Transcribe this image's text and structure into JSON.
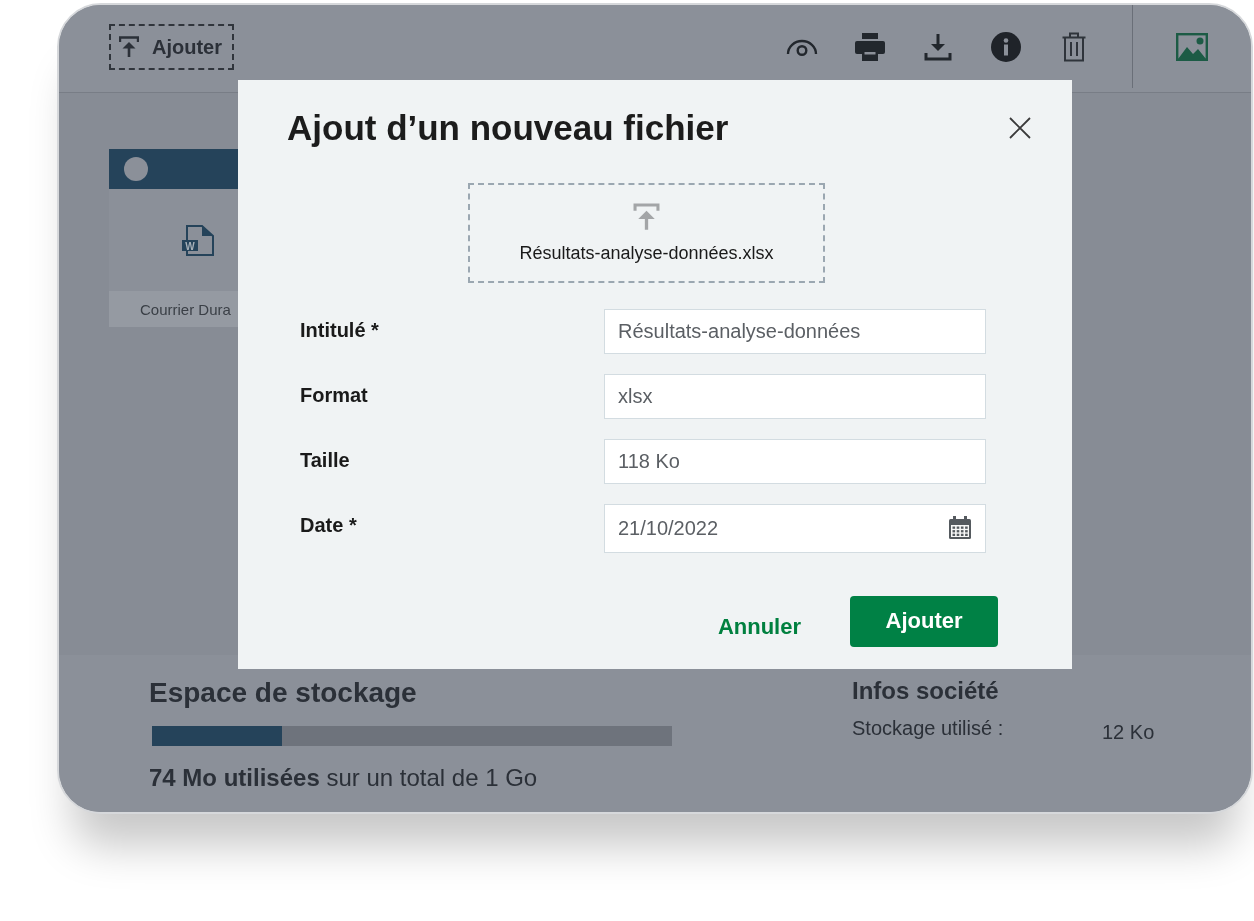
{
  "toolbar": {
    "add_button": "Ajouter"
  },
  "files": [
    {
      "name": "Courrier Dura",
      "type_badge": "W"
    }
  ],
  "dialog": {
    "title": "Ajout d’un nouveau fichier",
    "dropzone": {
      "filename": "Résultats-analyse-données.xlsx"
    },
    "fields": [
      {
        "label": "Intitulé *",
        "value": "Résultats-analyse-données",
        "kind": "text"
      },
      {
        "label": "Format",
        "value": "xlsx",
        "kind": "text"
      },
      {
        "label": "Taille",
        "value": "118 Ko",
        "kind": "text"
      },
      {
        "label": "Date *",
        "value": "21/10/2022",
        "kind": "date"
      }
    ],
    "buttons": [
      {
        "label": "Annuler",
        "kind": "secondary"
      },
      {
        "label": "Ajouter",
        "kind": "primary"
      }
    ]
  },
  "storage": {
    "title": "Espace de stockage",
    "level": 0.25,
    "summary": "**74 Mo utilisées** sur un total de 1 Go"
  },
  "company_info": {
    "title": "Infos société",
    "rows": [
      {
        "label": "Stockage utilisé :",
        "value": "12 Ko"
      }
    ]
  }
}
